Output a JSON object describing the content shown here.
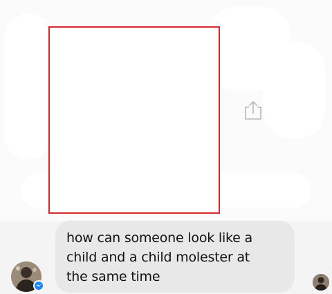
{
  "conversation": {
    "attachment": {
      "type": "image",
      "state": "blank"
    },
    "share_icon": "share-icon",
    "message": {
      "lines": [
        "how can someone look like a",
        "child and a child molester at",
        "the same time"
      ]
    },
    "sender_avatar_icon": "avatar",
    "badge_icon": "messenger-badge-icon",
    "read_receipt_icon": "seen-avatar"
  },
  "colors": {
    "frame_border": "#d9272e",
    "bubble_bg": "#e8e8e8",
    "badge": "#1e88f7"
  }
}
